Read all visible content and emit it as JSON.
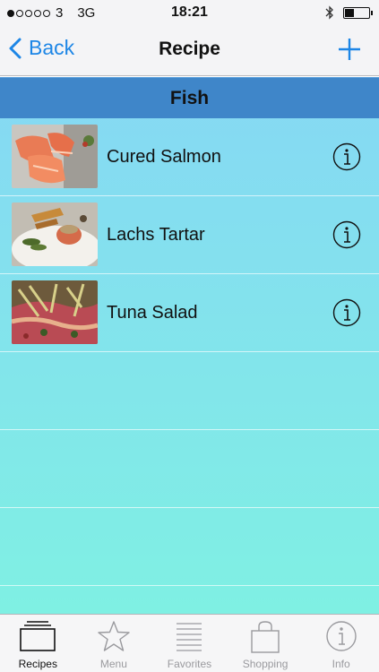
{
  "status_bar": {
    "carrier": "3",
    "network": "3G",
    "time": "18:21"
  },
  "nav": {
    "back_label": "Back",
    "title": "Recipe"
  },
  "section": {
    "title": "Fish"
  },
  "recipes": [
    {
      "name": "Cured Salmon"
    },
    {
      "name": "Lachs Tartar"
    },
    {
      "name": "Tuna Salad"
    }
  ],
  "tabs": [
    {
      "label": "Recipes",
      "icon": "recipes-icon"
    },
    {
      "label": "Menu",
      "icon": "star-icon"
    },
    {
      "label": "Favorites",
      "icon": "list-icon"
    },
    {
      "label": "Shopping",
      "icon": "bag-icon"
    },
    {
      "label": "Info",
      "icon": "info-icon"
    }
  ],
  "colors": {
    "accent": "#1d86e6",
    "section": "#3f86c9",
    "list_top": "#86d8f4",
    "list_bottom": "#7ff0e3"
  }
}
